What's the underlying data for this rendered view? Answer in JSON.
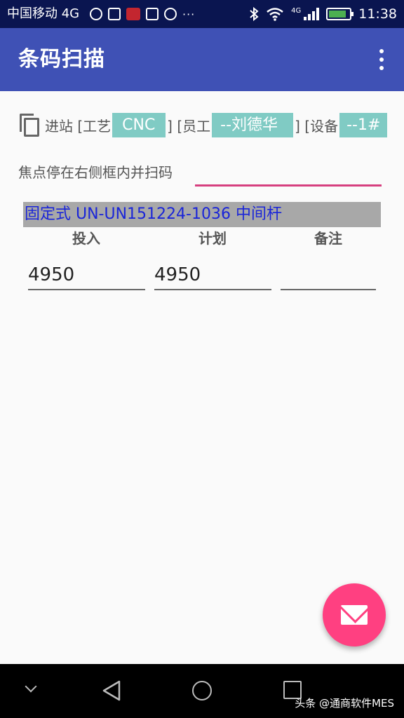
{
  "status_bar": {
    "carrier": "中国移动 4G",
    "time": "11:38",
    "net_label": "4G"
  },
  "app_bar": {
    "title": "条码扫描"
  },
  "info_row": {
    "station_label": "进站 [工艺",
    "process_value": "CNC",
    "employee_label": "] [员工",
    "employee_value": "--刘德华",
    "device_label": "] [设备",
    "device_value": "--1#"
  },
  "scan": {
    "label": "焦点停在右侧框内并扫码",
    "value": ""
  },
  "product": {
    "text": "固定式 UN-UN151224-1036 中间杆"
  },
  "columns": {
    "input_label": "投入",
    "plan_label": "计划",
    "note_label": "备注"
  },
  "fields": {
    "input_value": "4950",
    "plan_value": "4950",
    "note_value": ""
  },
  "fab": {
    "icon": "email-icon"
  },
  "nav_bar": {
    "watermark": "头条 @通商软件MES"
  },
  "colors": {
    "status_bar": "#0a1550",
    "app_bar": "#3f51b5",
    "chip": "#80cbc4",
    "accent_underline": "#d63f7f",
    "product_bar": "#a8a8a8",
    "product_text": "#1a25d8",
    "fab": "#ff4081"
  }
}
